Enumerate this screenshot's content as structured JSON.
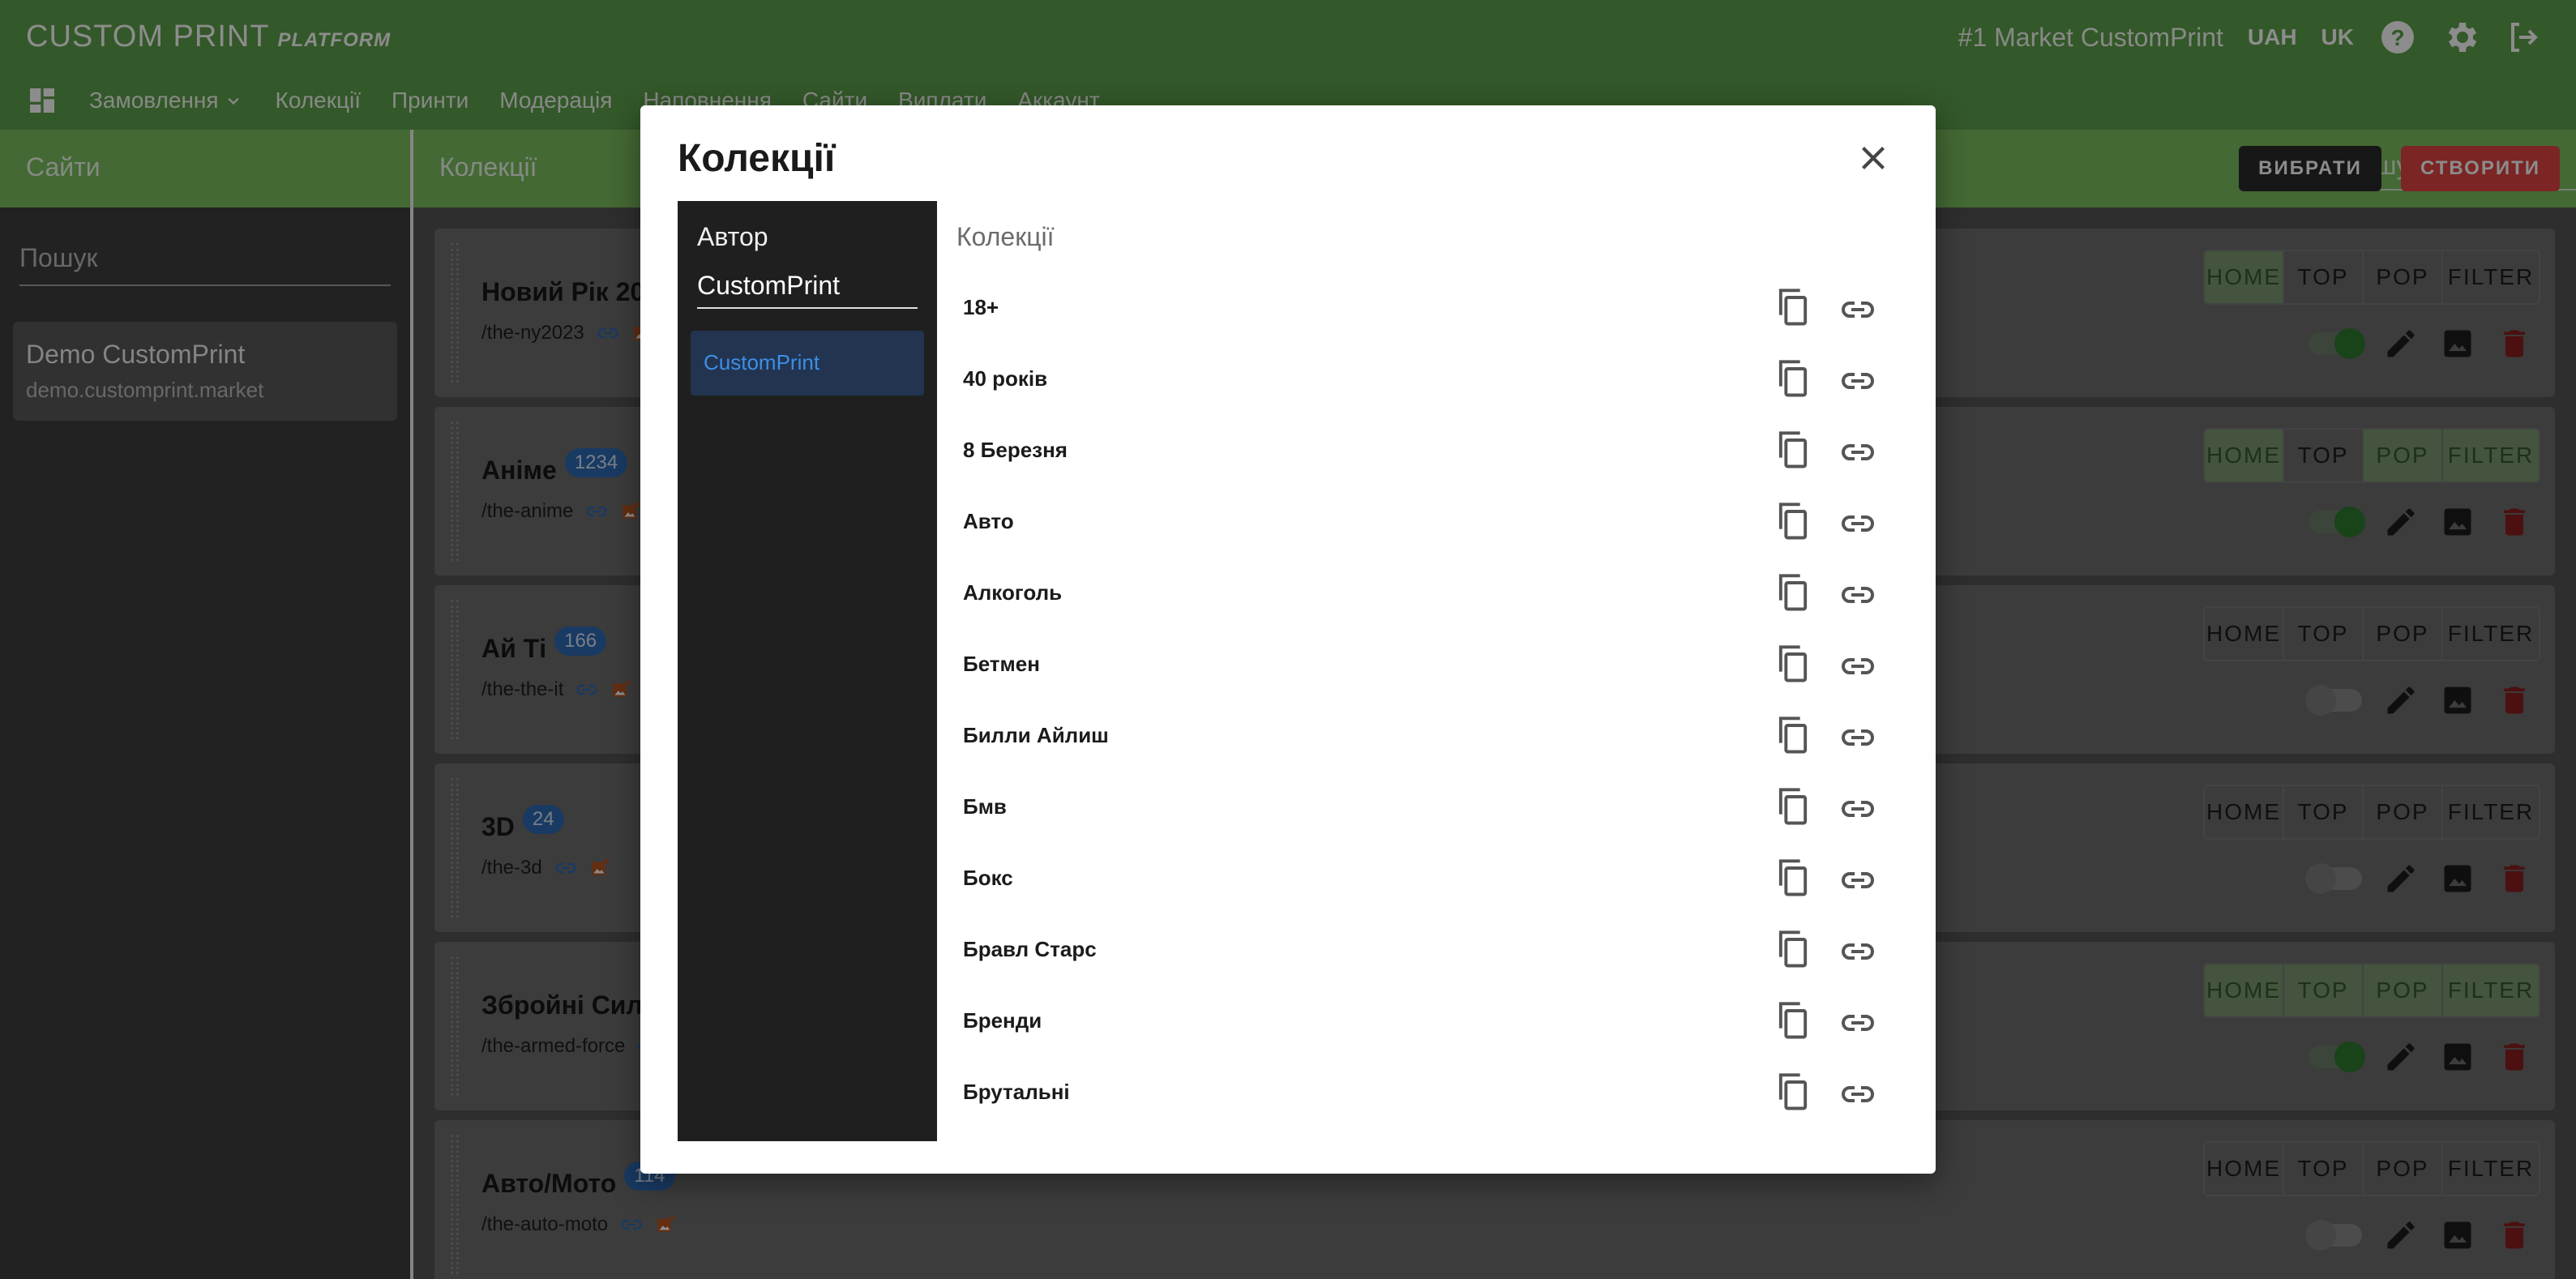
{
  "app": {
    "brand": "CUSTOM PRINT",
    "brand_sub": "PLATFORM",
    "market": "#1 Market CustomPrint",
    "currency": "UAH",
    "language": "UK",
    "accent_color": "#5ea04b"
  },
  "nav": {
    "items": [
      "Замовлення",
      "Колекції",
      "Принти",
      "Модерація",
      "Наповнення",
      "Сайти",
      "Виплати",
      "Аккаунт"
    ]
  },
  "left": {
    "title": "Сайти",
    "search_placeholder": "Пошук",
    "site": {
      "name": "Demo CustomPrint",
      "domain": "demo.customprint.market"
    }
  },
  "main": {
    "title": "Колекції",
    "search_placeholder": "Пошук",
    "select_label": "ВИБРАТИ",
    "create_label": "СТВОРИТИ",
    "tab_labels": [
      "HOME",
      "TOP",
      "POP",
      "FILTER"
    ],
    "cards": [
      {
        "title": "Новий Рік 20",
        "badge": "",
        "slug": "/the-ny2023",
        "enabled": true,
        "tabs_on": [
          true,
          false,
          false,
          false
        ]
      },
      {
        "title": "Аніме",
        "badge": "1234",
        "slug": "/the-anime",
        "enabled": true,
        "tabs_on": [
          true,
          false,
          true,
          true
        ]
      },
      {
        "title": "Ай Ті",
        "badge": "166",
        "slug": "/the-the-it",
        "enabled": false,
        "tabs_on": [
          false,
          false,
          false,
          false
        ]
      },
      {
        "title": "3D",
        "badge": "24",
        "slug": "/the-3d",
        "enabled": false,
        "tabs_on": [
          false,
          false,
          false,
          false
        ]
      },
      {
        "title": "Збройні Сили",
        "badge": "",
        "slug": "/the-armed-force",
        "enabled": true,
        "tabs_on": [
          true,
          true,
          true,
          true
        ]
      },
      {
        "title": "Авто/Мото",
        "badge": "114",
        "slug": "/the-auto-moto",
        "enabled": false,
        "tabs_on": [
          false,
          false,
          false,
          false
        ]
      }
    ]
  },
  "dialog": {
    "title": "Колекції",
    "author_label": "Автор",
    "author_value": "CustomPrint",
    "author_option": "CustomPrint",
    "list_header": "Колекції",
    "collections": [
      "18+",
      "40 років",
      "8 Березня",
      "Авто",
      "Алкоголь",
      "Бетмен",
      "Билли Айлиш",
      "Бмв",
      "Бокс",
      "Бравл Старс",
      "Бренди",
      "Брутальні"
    ]
  }
}
